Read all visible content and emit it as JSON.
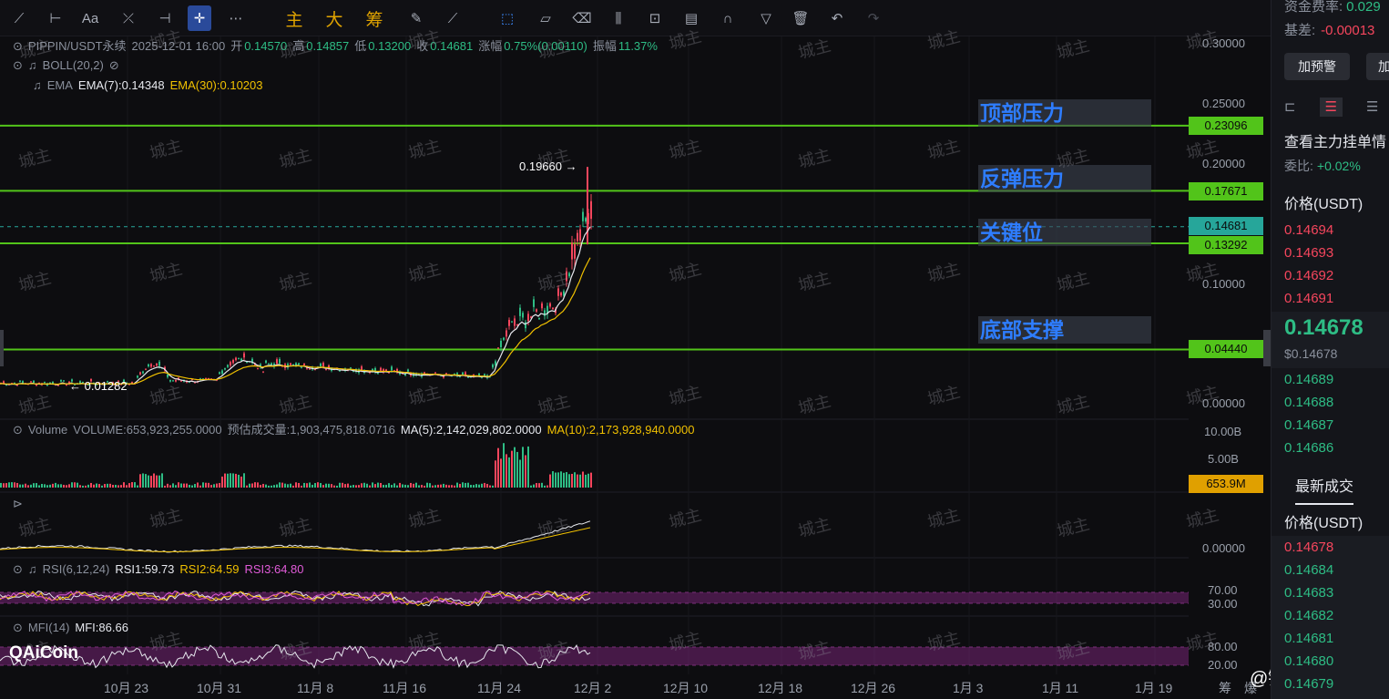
{
  "toolbar": {
    "cn_labels": [
      "主",
      "大",
      "筹"
    ],
    "tools": [
      "line-tool-icon",
      "horizontal-line-icon",
      "text-tool-icon",
      "fib-tool-icon",
      "ray-tool-icon",
      "crosshair-icon",
      "more-icon"
    ]
  },
  "header": {
    "symbol": "PIPPIN/USDT永续",
    "datetime": "2025-12-01 16:00",
    "open_label": "开",
    "open": "0.14570",
    "high_label": "高",
    "high": "0.14857",
    "low_label": "低",
    "low": "0.13200",
    "close_label": "收",
    "close": "0.14681",
    "change_label": "涨幅",
    "change": "0.75%(0.00110)",
    "amp_label": "振幅",
    "amp": "11.37%"
  },
  "indicators": {
    "boll": "BOLL(20,2)",
    "ema_name": "EMA",
    "ema7": "EMA(7):0.14348",
    "ema30": "EMA(30):0.10203",
    "volume_name": "Volume",
    "volume": "VOLUME:653,923,255.0000",
    "volume_est": "预估成交量:1,903,475,818.0716",
    "ma5": "MA(5):2,142,029,802.0000",
    "ma10": "MA(10):2,173,928,940.0000",
    "rsi_name": "RSI(6,12,24)",
    "rsi1": "RSI1:59.73",
    "rsi2": "RSI2:64.59",
    "rsi3": "RSI3:64.80",
    "mfi_name": "MFI(14)",
    "mfi": "MFI:86.66"
  },
  "levels": {
    "top_pressure": {
      "label": "顶部压力",
      "price": "0.23096"
    },
    "rebound_pressure": {
      "label": "反弹压力",
      "price": "0.17671"
    },
    "current": {
      "price": "0.14681"
    },
    "key_level": {
      "label": "关键位",
      "price": "0.13292"
    },
    "bottom_support": {
      "label": "底部支撑",
      "price": "0.04440"
    },
    "high_marker": "0.19660",
    "low_marker": "0.01282"
  },
  "price_axis": [
    "0.30000",
    "0.25000",
    "0.20000",
    "0.10000",
    "0.00000"
  ],
  "volume_axis": [
    "10.00B",
    "5.00B"
  ],
  "volume_tag": "653.9M",
  "macd_axis": "0.00000",
  "rsi_axis": [
    "70.00",
    "30.00"
  ],
  "mfi_axis": [
    "80.00",
    "20.00"
  ],
  "time_axis": [
    "10月 23",
    "10月 31",
    "11月 8",
    "11月 16",
    "11月 24",
    "12月 2",
    "12月 10",
    "12月 18",
    "12月 26",
    "1月 3",
    "1月 11",
    "1月 19"
  ],
  "time_axis_extra": [
    "筹",
    "爆"
  ],
  "watermark": "城主",
  "brand": "AiCoin",
  "weibo": "@链上城主",
  "side": {
    "funding_label": "资金费率:",
    "funding_value": "0.029",
    "basis_label": "基差:",
    "basis_value": "-0.00013",
    "alert_button": "加预警",
    "alert_button2": "加",
    "title": "查看主力挂单情",
    "ratio_label": "委比:",
    "ratio_value": "+0.02%",
    "price_header": "价格(USDT)",
    "asks": [
      "0.14694",
      "0.14693",
      "0.14692",
      "0.14691"
    ],
    "last_price": "0.14678",
    "last_price_usd": "$0.14678",
    "bids": [
      "0.14689",
      "0.14688",
      "0.14687",
      "0.14686"
    ],
    "trades_title": "最新成交",
    "trades_header": "价格(USDT)",
    "trades": [
      "0.14678",
      "0.14684",
      "0.14683",
      "0.14682",
      "0.14681",
      "0.14680",
      "0.14679"
    ]
  },
  "colors": {
    "level_line": "#52c41a",
    "up": "#2ebd85",
    "down": "#f6465d",
    "ema7": "#e6e8ee",
    "ema30": "#f0c000"
  }
}
